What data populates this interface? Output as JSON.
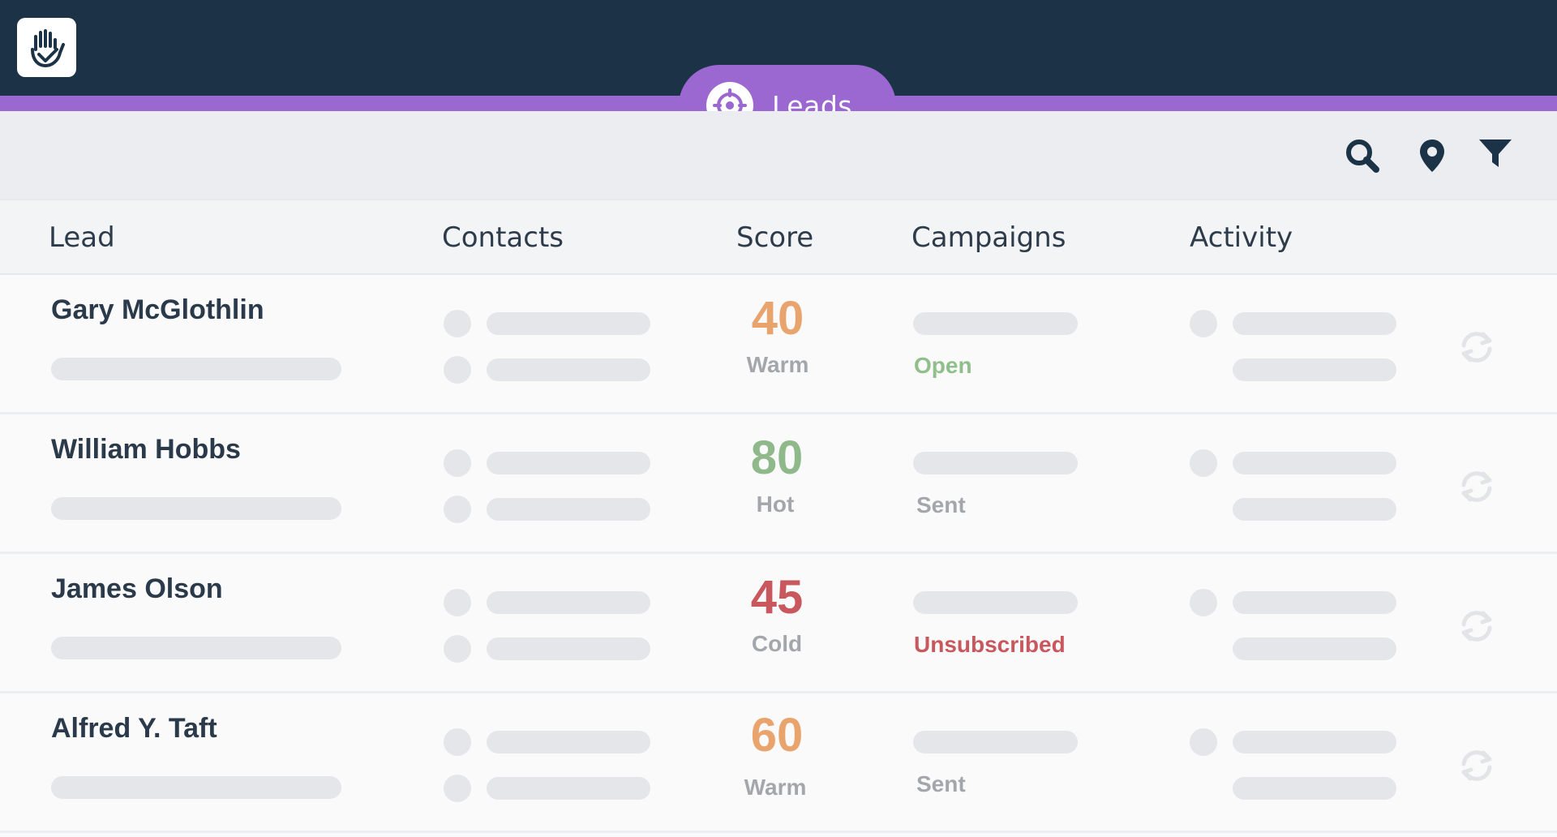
{
  "app": {
    "title": "Leads",
    "icons": {
      "logo": "hand-logo-icon",
      "pill": "target-icon",
      "search": "search-icon",
      "location": "map-pin-icon",
      "filter": "filter-icon",
      "refresh": "refresh-icon"
    },
    "colors": {
      "topbar": "#1c3347",
      "accent": "#9b68d1",
      "warm": "#e9a36d",
      "hot": "#8fb98a",
      "cold": "#c8585e",
      "open": "#8fbf8a",
      "unsubscribed": "#c8585e",
      "muted": "#a3a7ac"
    }
  },
  "table": {
    "columns": [
      "Lead",
      "Contacts",
      "Score",
      "Campaigns",
      "Activity"
    ],
    "rows": [
      {
        "name": "Gary McGlothlin",
        "score": "40",
        "score_label": "Warm",
        "score_color": "#e9a36d",
        "campaign": "Open",
        "campaign_color": "#8fbf8a"
      },
      {
        "name": "William Hobbs",
        "score": "80",
        "score_label": "Hot",
        "score_color": "#8fb98a",
        "campaign": "Sent",
        "campaign_color": "#a3a7ac"
      },
      {
        "name": "James Olson",
        "score": "45",
        "score_label": "Cold",
        "score_color": "#c8585e",
        "campaign": "Unsubscribed",
        "campaign_color": "#c8585e"
      },
      {
        "name": "Alfred Y. Taft",
        "score": "60",
        "score_label": "Warm",
        "score_color": "#e9a36d",
        "campaign": "Sent",
        "campaign_color": "#a3a7ac"
      }
    ]
  }
}
